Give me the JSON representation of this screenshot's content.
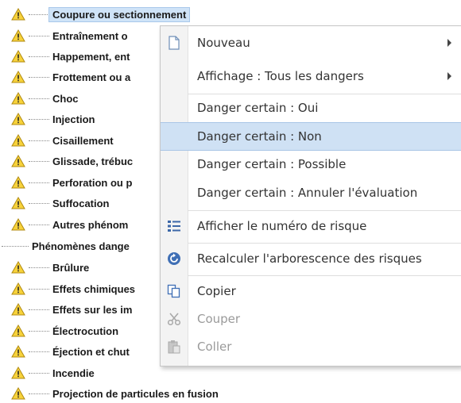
{
  "tree": {
    "items": [
      "Coupure ou sectionnement",
      "Entraînement o",
      "Happement, ent",
      "Frottement ou a",
      "Choc",
      "Injection",
      "Cisaillement",
      "Glissade, trébuc",
      "Perforation ou p",
      "Suffocation",
      "Autres phénom",
      "Phénomènes dange",
      "Brûlure",
      "Effets chimiques",
      "Effets sur les im",
      "Électrocution",
      "Éjection et chut",
      "Incendie",
      "Projection de particules en fusion"
    ]
  },
  "menu": {
    "nouveau": "Nouveau",
    "affichage": "Affichage : Tous les dangers",
    "oui": "Danger certain : Oui",
    "non": "Danger certain : Non",
    "possible": "Danger certain : Possible",
    "annuler": "Danger certain : Annuler l'évaluation",
    "afficher_numero": "Afficher le numéro de risque",
    "recalculer": "Recalculer l'arborescence des risques",
    "copier": "Copier",
    "couper": "Couper",
    "coller": "Coller"
  },
  "icons": {
    "warning": "warning-triangle-icon",
    "new": "new-document-icon",
    "list": "numbered-list-icon",
    "refresh": "refresh-icon",
    "copy": "copy-icon",
    "cut": "scissors-icon",
    "paste": "paste-icon"
  },
  "colors": {
    "selection": "#cfe3f7",
    "warning_fill": "#f7d23a",
    "warning_stroke": "#b08a10",
    "menu_highlight": "#cfe1f4"
  }
}
